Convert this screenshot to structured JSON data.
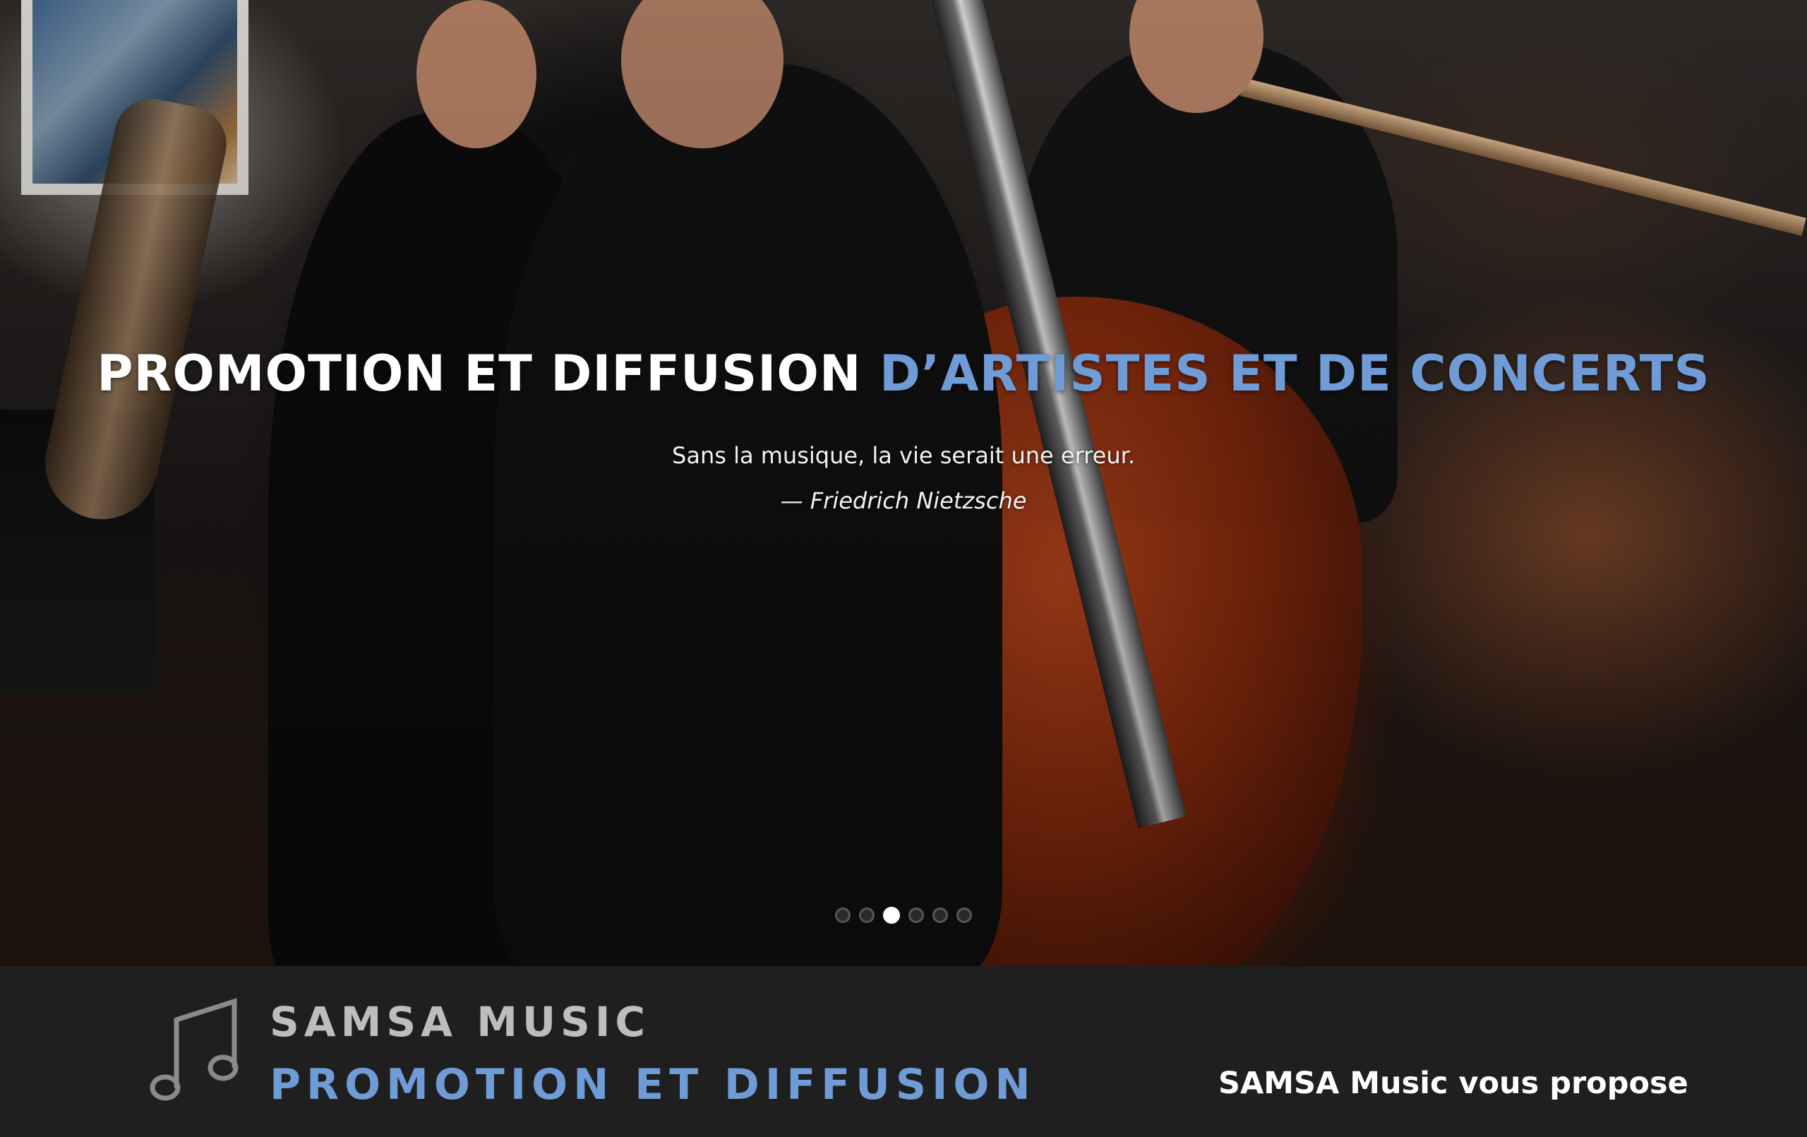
{
  "hero": {
    "title_main": "PROMOTION ET DIFFUSION ",
    "title_accent": "D’ARTISTES ET DE CONCERTS",
    "quote": "Sans la musique, la vie serait une erreur.",
    "author": "— Friedrich Nietzsche",
    "accent_color": "#6f9bd6",
    "slider": {
      "count": 6,
      "active_index": 2
    }
  },
  "brand": {
    "name": "SAMSA MUSIC",
    "tagline": "PROMOTION ET DIFFUSION",
    "icon": "music-note-icon"
  },
  "offer": {
    "title": "SAMSA Music vous propose"
  }
}
